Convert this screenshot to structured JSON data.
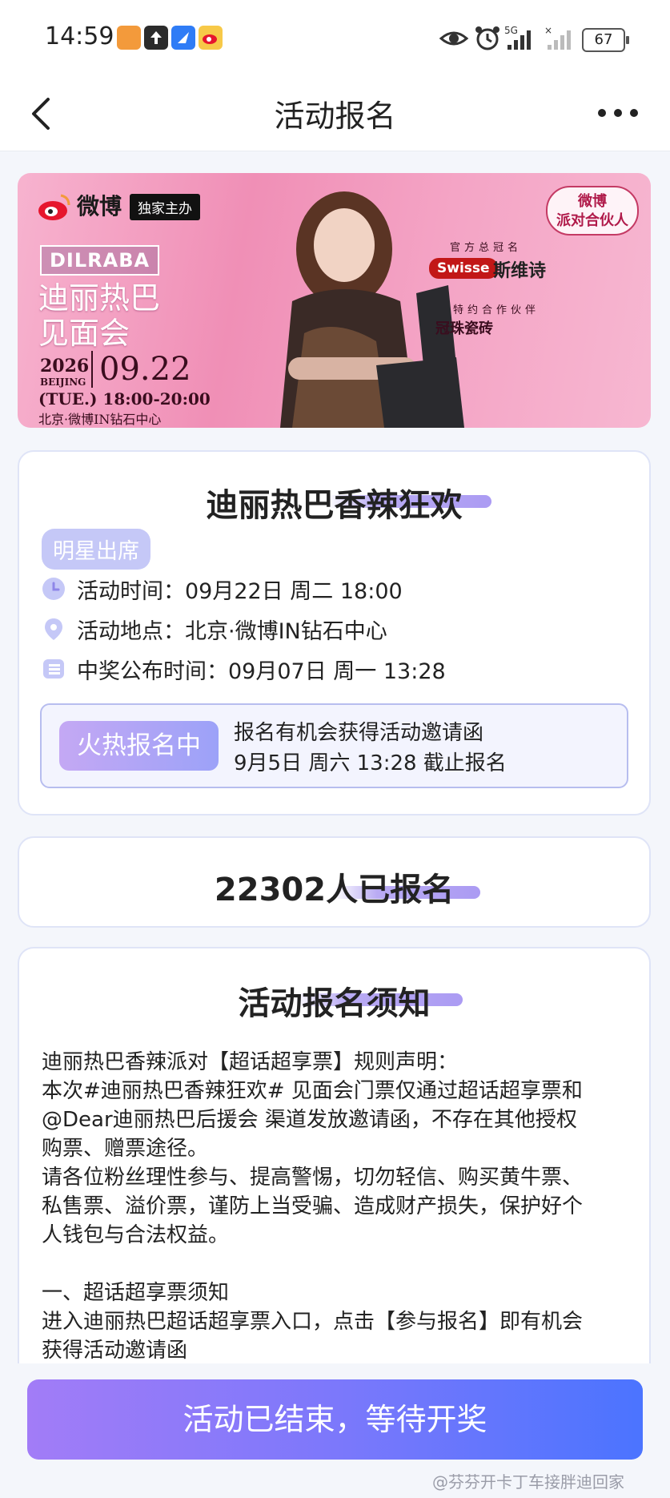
{
  "status_bar": {
    "time": "14:59",
    "battery": "67",
    "icons": [
      "app-icon-orange",
      "upload-icon",
      "bird-app-icon",
      "weibo-icon",
      "eye-icon",
      "alarm-icon",
      "signal-5g-icon",
      "signal-icon",
      "battery-icon"
    ]
  },
  "nav": {
    "title": "活动报名",
    "back_icon": "chevron-left-icon",
    "more_icon": "more-dots-icon"
  },
  "banner": {
    "platform": "微博",
    "exclusive": "独家主办",
    "artist_logo": "DILRABA",
    "event_name_cn_1": "迪丽热巴",
    "event_name_cn_2": "见面会",
    "year": "2026",
    "city_en": "BEIJING",
    "date": "09.22",
    "time": "(TUE.) 18:00-20:00",
    "venue": "北京·微博IN钻石中心",
    "party_badge_1": "微博",
    "party_badge_2": "派对合伙人",
    "sponsor_label": "官方总冠名",
    "sponsor_brand": "Swisse",
    "sponsor_brand_cn": "斯维诗",
    "partner_label": "特约合作伙伴",
    "partner_name": "冠珠瓷砖"
  },
  "event_card": {
    "title": "迪丽热巴香辣狂欢",
    "star_tag": "明星出席",
    "time_label": "活动时间：09月22日 周二 18:00",
    "place_label": "活动地点：北京·微博IN钻石中心",
    "announce_label": "中奖公布时间：09月07日 周一 13:28",
    "signup_status": "火热报名中",
    "signup_line1": "报名有机会获得活动邀请函",
    "signup_line2": "9月5日 周六 13:28 截止报名"
  },
  "count_card": {
    "text": "22302人已报名"
  },
  "notice_card": {
    "title": "活动报名须知",
    "lines": [
      "迪丽热巴香辣派对【超话超享票】规则声明：",
      "本次#迪丽热巴香辣狂欢# 见面会门票仅通过超话超享票和",
      "@Dear迪丽热巴后援会 渠道发放邀请函，不存在其他授权",
      "购票、赠票途径。",
      "请各位粉丝理性参与、提高警惕，切勿轻信、购买黄牛票、",
      "私售票、溢价票，谨防上当受骗、造成财产损失，保护好个",
      "人钱包与合法权益。",
      "",
      "一、超话超享票须知",
      "进入迪丽热巴超话超享票入口，点击【参与报名】即有机会",
      "获得活动邀请函"
    ]
  },
  "bottom_button": "活动已结束，等待开奖",
  "watermark": "@芬芬开卡丁车接胖迪回家",
  "colors": {
    "accent_purple": "#9ca2f8",
    "button_start": "#a27cf7",
    "button_end": "#4b74ff",
    "card_border": "#dfe4f7"
  }
}
